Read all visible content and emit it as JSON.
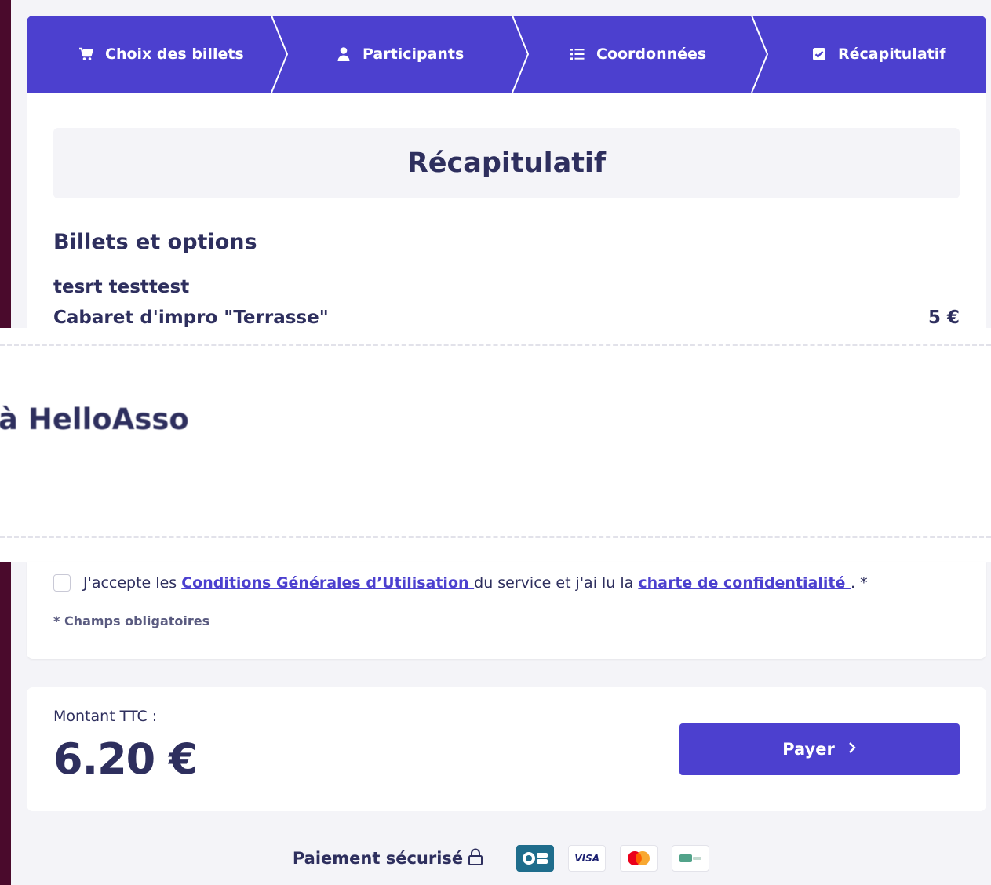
{
  "steps": [
    {
      "label": "Choix des billets",
      "icon": "cart-icon"
    },
    {
      "label": "Participants",
      "icon": "user-icon"
    },
    {
      "label": "Coordonnées",
      "icon": "list-icon"
    },
    {
      "label": "Récapitulatif",
      "icon": "checkbox-icon"
    }
  ],
  "summary": {
    "title": "Récapitulatif",
    "section_title": "Billets et options",
    "participant": "tesrt testtest",
    "item_name": "Cabaret d'impro \"Terrasse\"",
    "item_price": "5 €"
  },
  "partial_text": "à HelloAsso",
  "consent": {
    "prefix": "J'accepte les ",
    "cgu_link": "Conditions Générales d’Utilisation ",
    "middle": "du service et j'ai lu la ",
    "privacy_link": "charte de confidentialité ",
    "suffix": ". *"
  },
  "required_note": "* Champs obligatoires",
  "total": {
    "label": "Montant TTC :",
    "amount": "6.20 €",
    "pay_label": "Payer"
  },
  "footer": {
    "secure_label": "Paiement sécurisé",
    "payment_methods": [
      "CB",
      "VISA",
      "Mastercard",
      "PayLib"
    ]
  },
  "colors": {
    "primary": "#4c40cf",
    "text": "#2e2f5e",
    "outer": "#4a0a2c"
  }
}
